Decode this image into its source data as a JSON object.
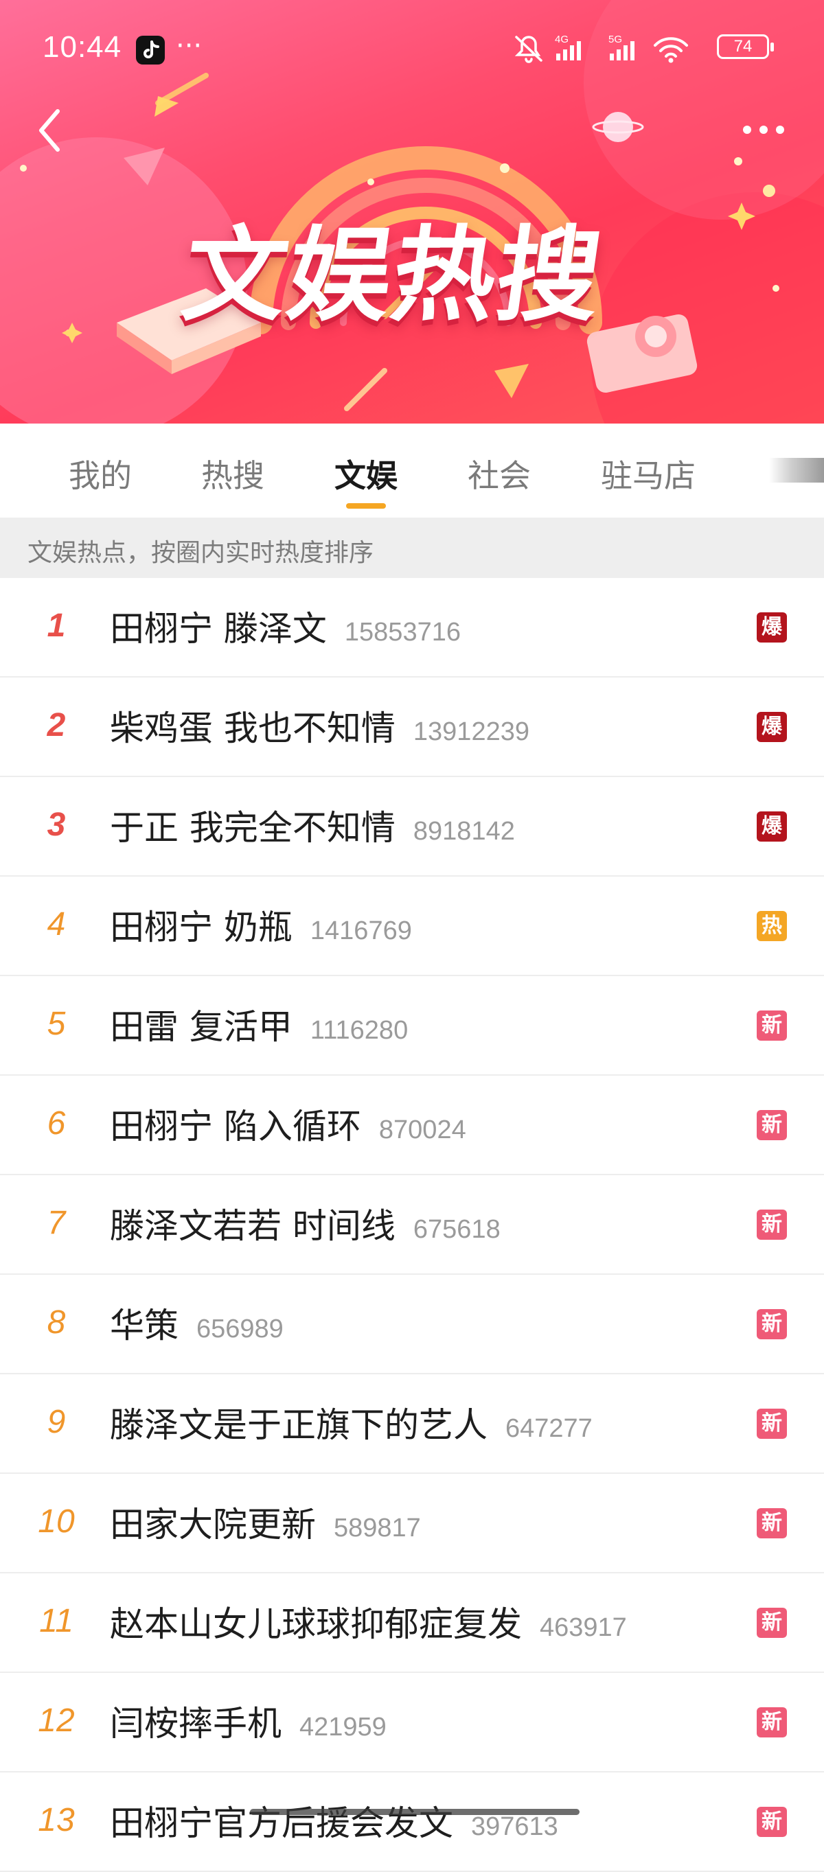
{
  "status_bar": {
    "time": "10:44",
    "more_dots": "···",
    "network_labels": [
      "4G",
      "5G"
    ],
    "battery": "74"
  },
  "banner": {
    "title": "文娱热搜",
    "colors": {
      "primary": "#ff4d6e",
      "accent": "#ffd86b"
    }
  },
  "tabs": [
    {
      "label": "我的",
      "active": false
    },
    {
      "label": "热搜",
      "active": false
    },
    {
      "label": "文娱",
      "active": true
    },
    {
      "label": "社会",
      "active": false
    },
    {
      "label": "驻马店",
      "active": false
    }
  ],
  "subheader": "文娱热点，按圈内实时热度排序",
  "items": [
    {
      "rank": "1",
      "title": "田栩宁 滕泽文",
      "count": "15853716",
      "badge": "爆"
    },
    {
      "rank": "2",
      "title": "柴鸡蛋 我也不知情",
      "count": "13912239",
      "badge": "爆"
    },
    {
      "rank": "3",
      "title": "于正 我完全不知情",
      "count": "8918142",
      "badge": "爆"
    },
    {
      "rank": "4",
      "title": "田栩宁 奶瓶",
      "count": "1416769",
      "badge": "热"
    },
    {
      "rank": "5",
      "title": "田雷 复活甲",
      "count": "1116280",
      "badge": "新"
    },
    {
      "rank": "6",
      "title": "田栩宁 陷入循环",
      "count": "870024",
      "badge": "新"
    },
    {
      "rank": "7",
      "title": "滕泽文若若 时间线",
      "count": "675618",
      "badge": "新"
    },
    {
      "rank": "8",
      "title": "华策",
      "count": "656989",
      "badge": "新"
    },
    {
      "rank": "9",
      "title": "滕泽文是于正旗下的艺人",
      "count": "647277",
      "badge": "新"
    },
    {
      "rank": "10",
      "title": "田家大院更新",
      "count": "589817",
      "badge": "新"
    },
    {
      "rank": "11",
      "title": "赵本山女儿球球抑郁症复发",
      "count": "463917",
      "badge": "新"
    },
    {
      "rank": "12",
      "title": "闫桉摔手机",
      "count": "421959",
      "badge": "新"
    },
    {
      "rank": "13",
      "title": "田栩宁官方后援会发文",
      "count": "397613",
      "badge": "新"
    }
  ],
  "badge_colors": {
    "爆": "#b4141d",
    "热": "#f4a625",
    "新": "#ef5a77"
  },
  "rank_colors": {
    "top": "#e8504a",
    "normal": "#f0962b"
  }
}
